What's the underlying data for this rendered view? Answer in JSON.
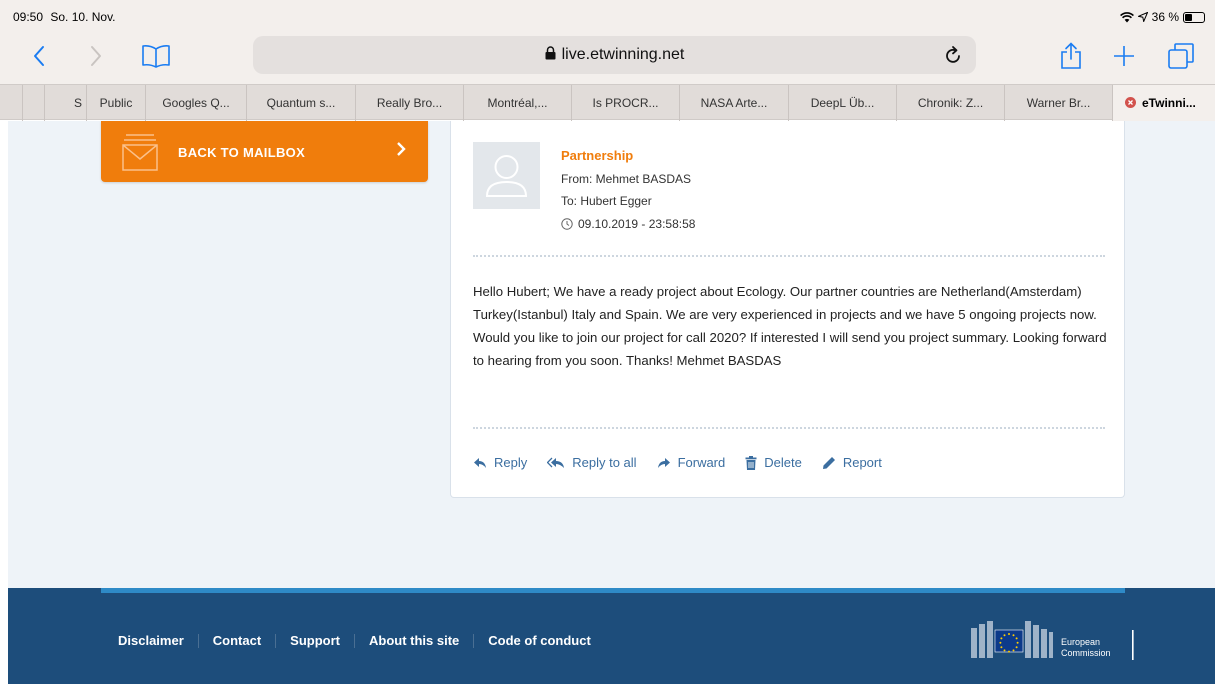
{
  "status_bar": {
    "time": "09:50",
    "date": "So. 10. Nov.",
    "battery": "36 %",
    "battery_level": 0.36
  },
  "browser": {
    "url": "live.etwinning.net",
    "icons": [
      "back-icon",
      "forward-icon",
      "bookmarks-icon",
      "lock-icon",
      "reload-icon",
      "share-icon",
      "new-tab-icon",
      "tabs-icon"
    ]
  },
  "bookmarks": [
    {
      "label": "S"
    },
    {
      "label": "Public"
    },
    {
      "label": "Googles Q..."
    },
    {
      "label": "Quantum s..."
    },
    {
      "label": "Really Bro..."
    },
    {
      "label": "Montréal,..."
    },
    {
      "label": "Is PROCR..."
    },
    {
      "label": "NASA Arte..."
    },
    {
      "label": "DeepL Üb..."
    },
    {
      "label": "Chronik: Z..."
    },
    {
      "label": "Warner Br..."
    },
    {
      "label": "eTwinni..."
    }
  ],
  "sidebar": {
    "back_button": "BACK TO MAILBOX"
  },
  "message": {
    "subject": "Partnership",
    "from": "From: Mehmet BASDAS",
    "to": "To: Hubert Egger",
    "date": "09.10.2019 - 23:58:58",
    "body": "Hello Hubert; We have a ready project about Ecology. Our partner countries are Netherland(Amsterdam) Turkey(Istanbul) Italy and Spain. We are very experienced in projects and we have 5 ongoing projects now. Would you like to join our project for call 2020? If interested I will send you project summary. Looking forward to hearing from you soon. Thanks! Mehmet BASDAS",
    "actions": {
      "reply": "Reply",
      "reply_all": "Reply to all",
      "forward": "Forward",
      "delete": "Delete",
      "report": "Report"
    }
  },
  "footer": {
    "links": [
      "Disclaimer",
      "Contact",
      "Support",
      "About this site",
      "Code of conduct"
    ],
    "logo_text_1": "European",
    "logo_text_2": "Commission"
  },
  "colors": {
    "accent_orange": "#f07d0c",
    "link_blue": "#3b6ea0",
    "footer_bg": "#1d4d7b",
    "page_bg": "#eef3f8"
  }
}
